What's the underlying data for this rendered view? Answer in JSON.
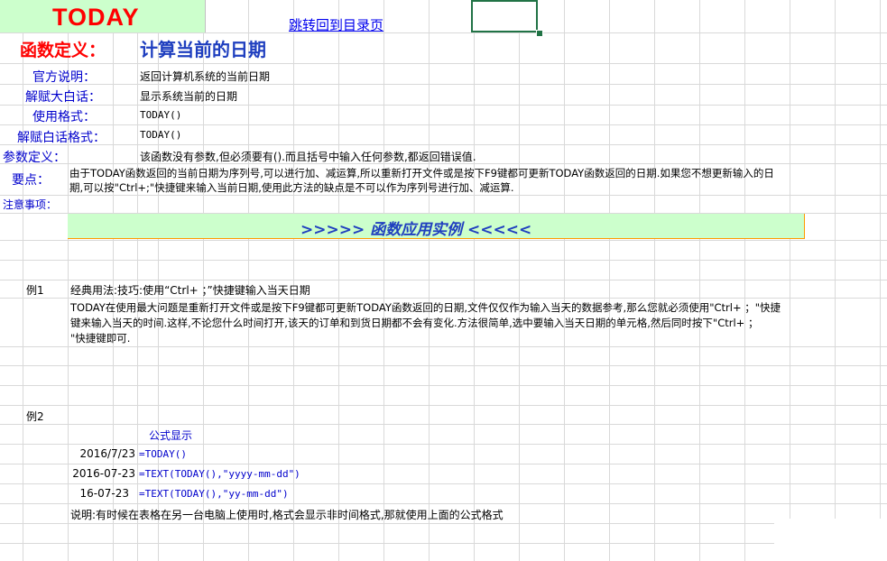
{
  "header": {
    "title": "TODAY",
    "back_link": "跳转回到目录页"
  },
  "definition": {
    "label": "函数定义：",
    "value": "计算当前的日期"
  },
  "rows": {
    "official": {
      "label": "官方说明：",
      "value": "返回计算机系统的当前日期"
    },
    "plain": {
      "label": "解赋大白话：",
      "value": "显示系统当前的日期"
    },
    "usage": {
      "label": "使用格式：",
      "value": "TODAY()"
    },
    "plain_usage": {
      "label": "解赋白话格式：",
      "value": "TODAY()"
    },
    "params": {
      "label": "参数定义：",
      "value": "该函数没有参数,但必须要有().而且括号中输入任何参数,都返回错误值."
    },
    "keypoint": {
      "label": "要点：",
      "line1": "由于TODAY函数返回的当前日期为序列号,可以进行加、减运算,所以重新打开文件或是按下F9键都可更新TODAY函数返回的日期.如果您不想更新输入的日",
      "line2": "期,可以按\"Ctrl+;\"快捷键来输入当前日期,使用此方法的缺点是不可以作为序列号进行加、减运算."
    },
    "notes": {
      "label": "注意事项："
    }
  },
  "banner": {
    "text": ">>>>>   函数应用实例   <<<<<"
  },
  "example1": {
    "label": "例1",
    "title": "经典用法:技巧:使用“Ctrl+ ；”快捷键输入当天日期",
    "line1": "TODAY在使用最大问题是重新打开文件或是按下F9键都可更新TODAY函数返回的日期,文件仅仅作为输入当天的数据参考,那么您就必须使用\"Ctrl+ ；\"快捷",
    "line2": "键来输入当天的时间.这样,不论您什么时间打开,该天的订单和到货日期都不会有变化.方法很简单,选中要输入当天日期的单元格,然后同时按下\"Ctrl+ ；",
    "line3": "\"快捷键即可."
  },
  "example2": {
    "label": "例2",
    "header": "公式显示",
    "rows": [
      {
        "value": "2016/7/23",
        "formula": "=TODAY()"
      },
      {
        "value": "2016-07-23",
        "formula": "=TEXT(TODAY(),\"yyyy-mm-dd\")"
      },
      {
        "value": "16-07-23",
        "formula": "=TEXT(TODAY(),\"yy-mm-dd\")"
      }
    ],
    "note": "说明:有时候在表格在另一台电脑上使用时,格式会显示非时间格式,那就使用上面的公式格式"
  }
}
